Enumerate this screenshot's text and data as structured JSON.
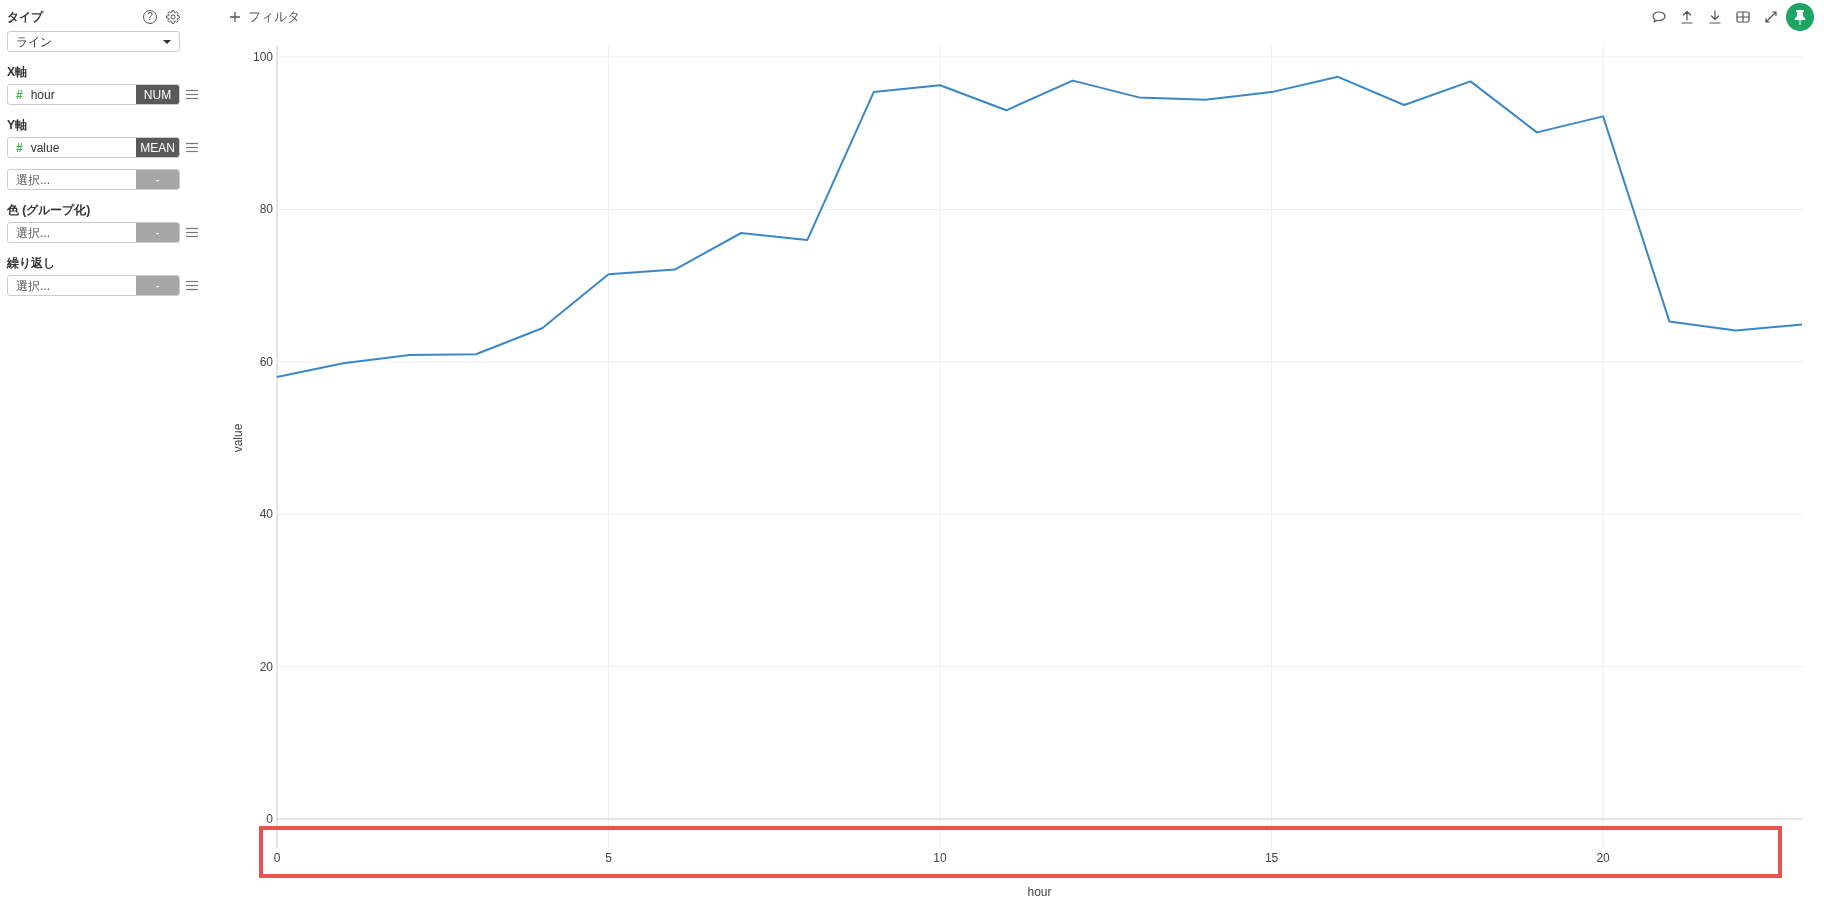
{
  "sidebar": {
    "type_label": "タイプ",
    "help_icon": "?",
    "chart_type": {
      "value": "ライン"
    },
    "groups": [
      {
        "label": "X軸",
        "type_mark": "#",
        "value": "hour",
        "badge": "NUM",
        "badge_active": true,
        "menu": true
      },
      {
        "label": "Y軸",
        "type_mark": "#",
        "value": "value",
        "badge": "MEAN",
        "badge_active": true,
        "menu": true
      },
      {
        "placeholder": "選択...",
        "badge": "-",
        "badge_active": false,
        "menu": false
      },
      {
        "label": "色 (グループ化)",
        "placeholder": "選択...",
        "badge": "-",
        "badge_active": false,
        "menu": true
      },
      {
        "label": "繰り返し",
        "placeholder": "選択...",
        "badge": "-",
        "badge_active": false,
        "menu": true
      }
    ]
  },
  "toolbar": {
    "filter_button": "フィルタ",
    "pinned": true
  },
  "chart": {
    "chart_data": {
      "type": "line",
      "xlabel": "hour",
      "ylabel": "value",
      "x": [
        0,
        1,
        2,
        3,
        4,
        5,
        6,
        7,
        8,
        9,
        10,
        11,
        12,
        13,
        14,
        15,
        16,
        17,
        18,
        19,
        20,
        21,
        22,
        23
      ],
      "series": [
        {
          "color": "#3a87c6",
          "values": [
            58.0,
            59.8,
            60.9,
            61.0,
            64.4,
            71.5,
            72.1,
            76.9,
            76.0,
            95.4,
            96.3,
            93.0,
            96.9,
            94.7,
            94.4,
            95.4,
            97.4,
            93.7,
            96.8,
            90.1,
            92.2,
            65.3,
            64.1,
            64.9
          ]
        }
      ],
      "xlim": [
        0,
        23
      ],
      "ylim": [
        0,
        100
      ],
      "xticks": [
        0,
        5,
        10,
        15,
        20
      ],
      "yticks": [
        0,
        20,
        40,
        60,
        80,
        100
      ],
      "grid": true
    },
    "highlight": {
      "kind": "xtick_labels"
    }
  }
}
